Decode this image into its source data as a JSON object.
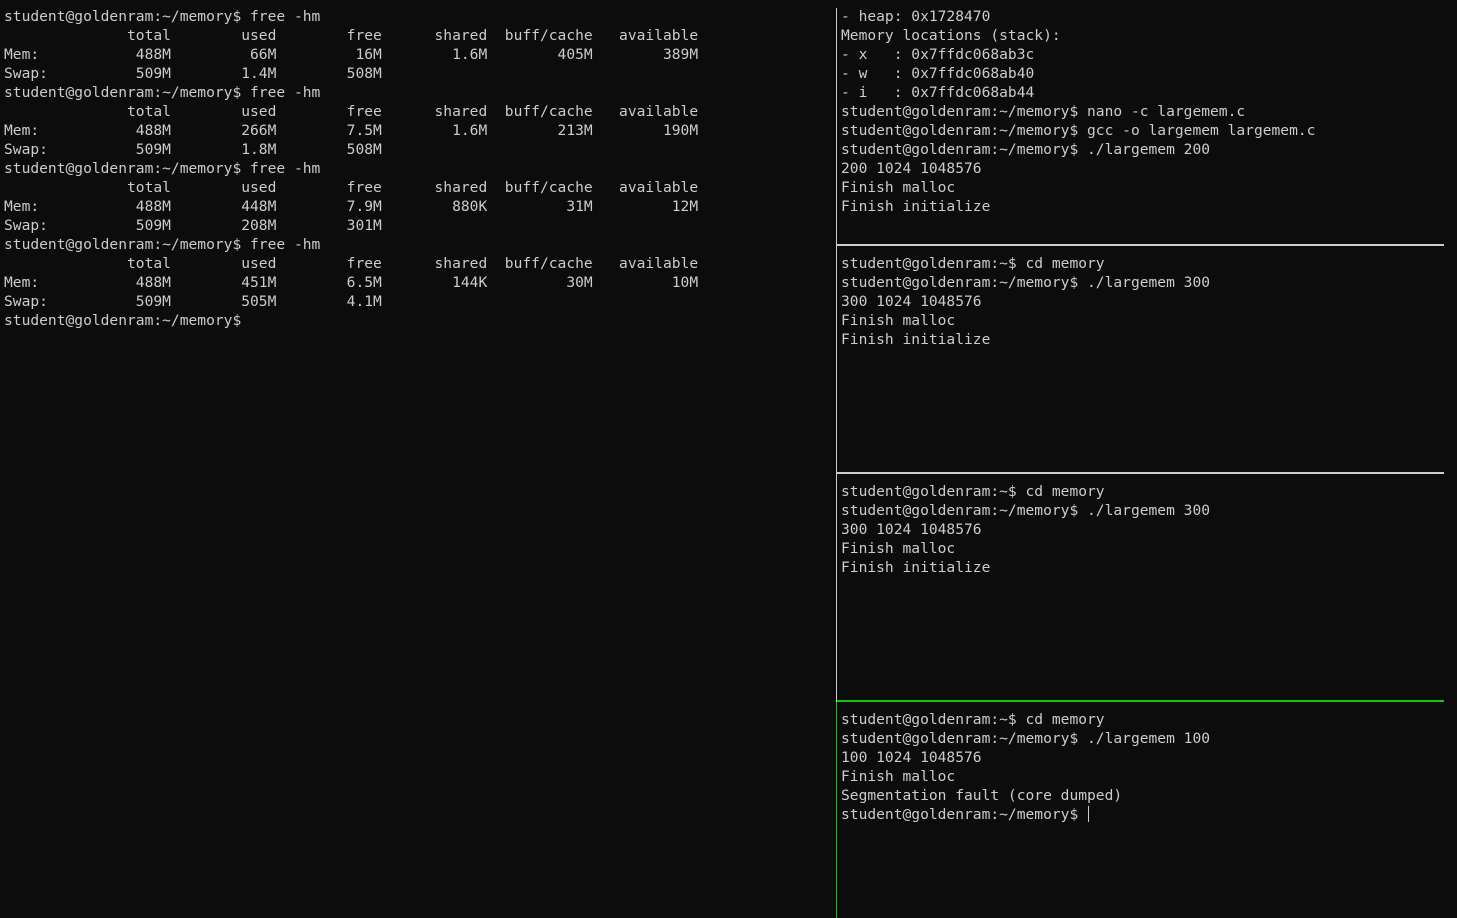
{
  "colors": {
    "background": "#0c0c0c",
    "foreground": "#cccccc",
    "divider": "#cccccc",
    "active_divider": "#16c60c"
  },
  "panes": {
    "left": {
      "lines": [
        "student@goldenram:~/memory$ free -hm",
        "              total        used        free      shared  buff/cache   available",
        "Mem:           488M         66M         16M        1.6M        405M        389M",
        "Swap:          509M        1.4M        508M",
        "student@goldenram:~/memory$ free -hm",
        "              total        used        free      shared  buff/cache   available",
        "Mem:           488M        266M        7.5M        1.6M        213M        190M",
        "Swap:          509M        1.8M        508M",
        "student@goldenram:~/memory$ free -hm",
        "              total        used        free      shared  buff/cache   available",
        "Mem:           488M        448M        7.9M        880K         31M         12M",
        "Swap:          509M        208M        301M",
        "student@goldenram:~/memory$ free -hm",
        "              total        used        free      shared  buff/cache   available",
        "Mem:           488M        451M        6.5M        144K         30M         10M",
        "Swap:          509M        505M        4.1M",
        "student@goldenram:~/memory$"
      ]
    },
    "right_1": {
      "lines": [
        "- heap: 0x1728470",
        "Memory locations (stack):",
        "- x   : 0x7ffdc068ab3c",
        "- w   : 0x7ffdc068ab40",
        "- i   : 0x7ffdc068ab44",
        "student@goldenram:~/memory$ nano -c largemem.c",
        "student@goldenram:~/memory$ gcc -o largemem largemem.c",
        "student@goldenram:~/memory$ ./largemem 200",
        "200 1024 1048576",
        "Finish malloc",
        "Finish initialize"
      ]
    },
    "right_2": {
      "lines": [
        "student@goldenram:~$ cd memory",
        "student@goldenram:~/memory$ ./largemem 300",
        "300 1024 1048576",
        "Finish malloc",
        "Finish initialize"
      ]
    },
    "right_3": {
      "lines": [
        "student@goldenram:~$ cd memory",
        "student@goldenram:~/memory$ ./largemem 300",
        "300 1024 1048576",
        "Finish malloc",
        "Finish initialize"
      ]
    },
    "right_4": {
      "lines": [
        "student@goldenram:~$ cd memory",
        "student@goldenram:~/memory$ ./largemem 100",
        "100 1024 1048576",
        "Finish malloc",
        "Segmentation fault (core dumped)"
      ],
      "prompt": "student@goldenram:~/memory$ "
    }
  }
}
